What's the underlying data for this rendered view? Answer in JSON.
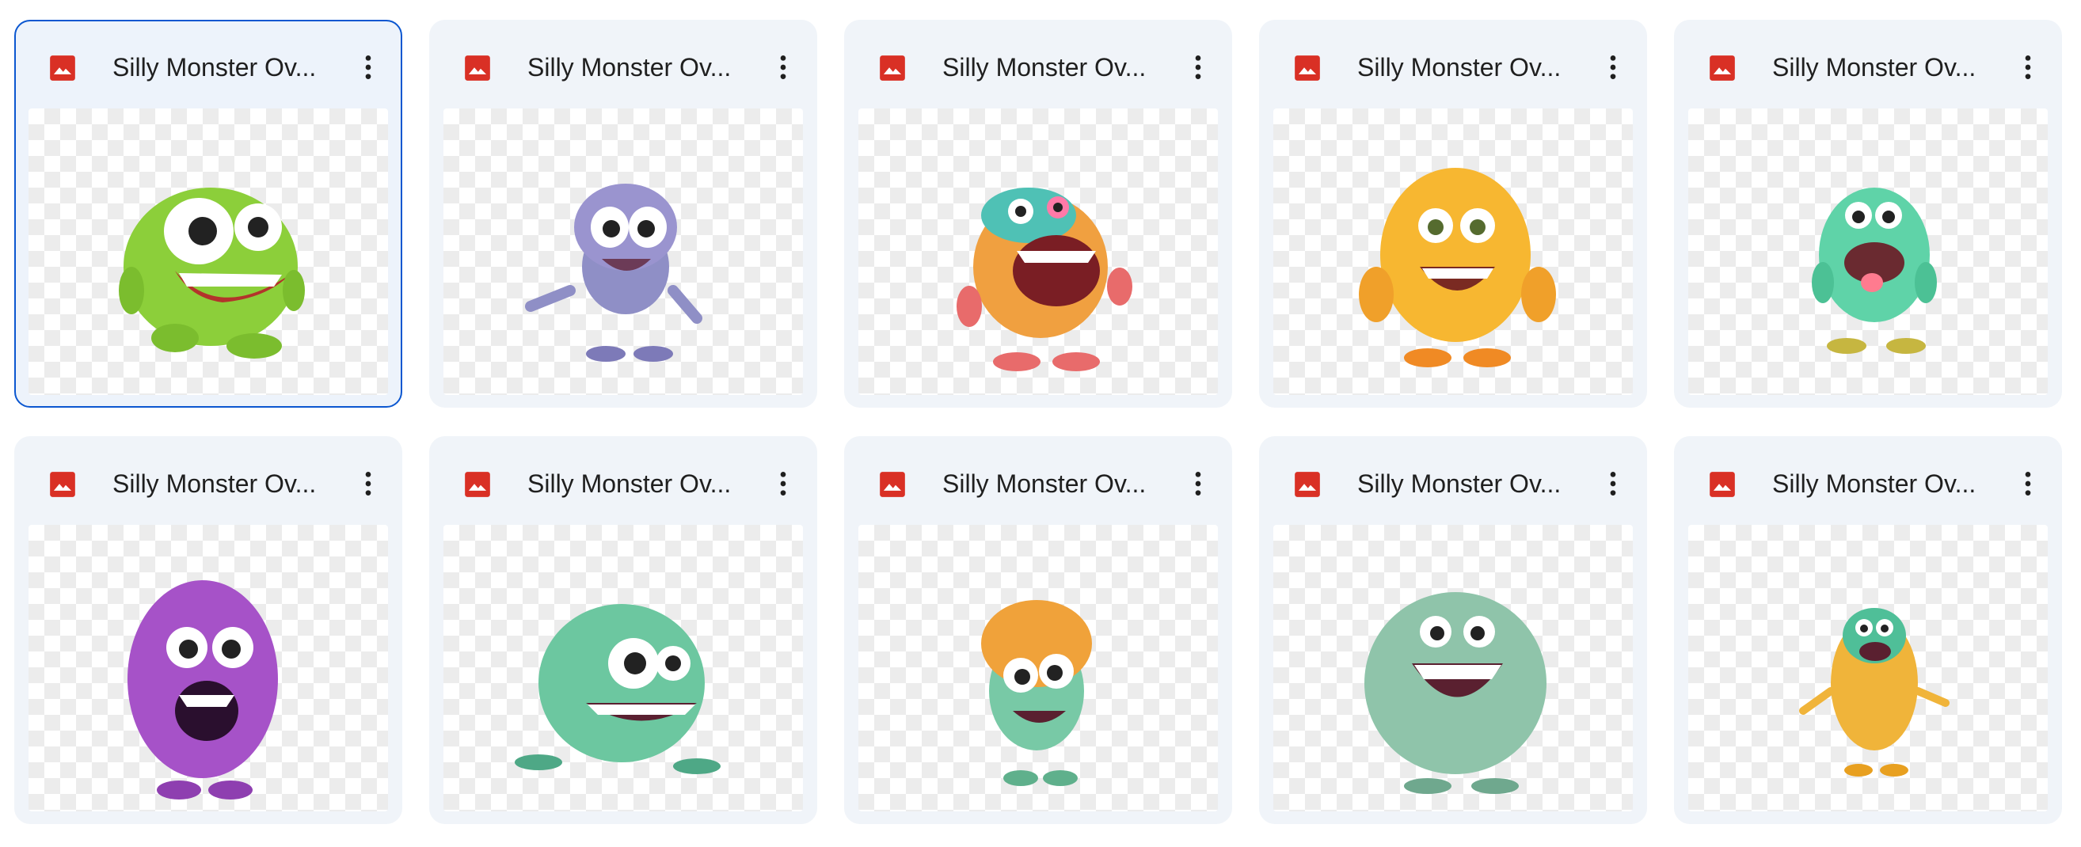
{
  "colors": {
    "card_bg": "#f0f4f9",
    "selected_border": "#0b57d0",
    "image_icon": "#d93025"
  },
  "icons": {
    "file_type": "image-file-icon",
    "more": "more-vert-icon"
  },
  "files": [
    {
      "name": "Silly Monster Ov...",
      "selected": true
    },
    {
      "name": "Silly Monster Ov...",
      "selected": false
    },
    {
      "name": "Silly Monster Ov...",
      "selected": false
    },
    {
      "name": "Silly Monster Ov...",
      "selected": false
    },
    {
      "name": "Silly Monster Ov...",
      "selected": false
    },
    {
      "name": "Silly Monster Ov...",
      "selected": false
    },
    {
      "name": "Silly Monster Ov...",
      "selected": false
    },
    {
      "name": "Silly Monster Ov...",
      "selected": false
    },
    {
      "name": "Silly Monster Ov...",
      "selected": false
    },
    {
      "name": "Silly Monster Ov...",
      "selected": false
    }
  ]
}
